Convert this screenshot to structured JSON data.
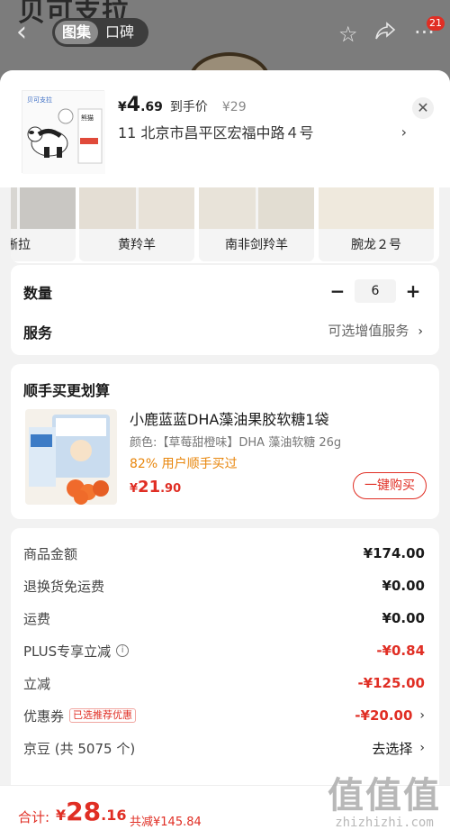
{
  "background": {
    "brand_fragment": "贝可支拉",
    "segment_tabs": [
      "图集",
      "口碑"
    ],
    "badge_count": "21"
  },
  "product": {
    "price_symbol": "¥",
    "price_int": "4",
    "price_dec": ".69",
    "price_label": "到手价",
    "original_price": "¥29",
    "address": "11  北京市昌平区宏福中路４号"
  },
  "variants": [
    {
      "label": "蜥拉"
    },
    {
      "label": "黄羚羊"
    },
    {
      "label": "南非剑羚羊"
    },
    {
      "label": "腕龙２号"
    }
  ],
  "quantity": {
    "label": "数量",
    "value": "6",
    "minus": "−",
    "plus": "+"
  },
  "service": {
    "label": "服务",
    "value": "可选增值服务"
  },
  "bundle": {
    "title": "顺手买更划算",
    "name": "小鹿蓝蓝DHA藻油果胶软糖1袋",
    "spec": "颜色:【草莓甜橙味】DHA 藻油软糖 26g",
    "buyers": "82% 用户顺手买过",
    "price_symbol": "¥",
    "price_int": "21",
    "price_dec": ".90",
    "button": "一键购买"
  },
  "summary": {
    "rows": [
      {
        "label": "商品金额",
        "value": "¥174.00"
      },
      {
        "label": "退换货免运费",
        "value": "¥0.00"
      },
      {
        "label": "运费",
        "value": "¥0.00"
      },
      {
        "label": "PLUS专享立减",
        "value": "-¥0.84"
      },
      {
        "label": "立减",
        "value": "-¥125.00"
      },
      {
        "label": "优惠券",
        "tag": "已选推荐优惠",
        "value": "-¥20.00"
      },
      {
        "label": "京豆 (共 5075 个)",
        "value": "去选择"
      }
    ]
  },
  "footer": {
    "total_label": "合计:",
    "total_symbol": "¥",
    "total_int": "28",
    "total_dec": ".16",
    "saved": "共减¥145.84",
    "watermark_big": "值值值",
    "watermark_small": "zhizhizhi.com"
  },
  "colors": {
    "accent_red": "#e02e24",
    "orange": "#e8860c"
  }
}
